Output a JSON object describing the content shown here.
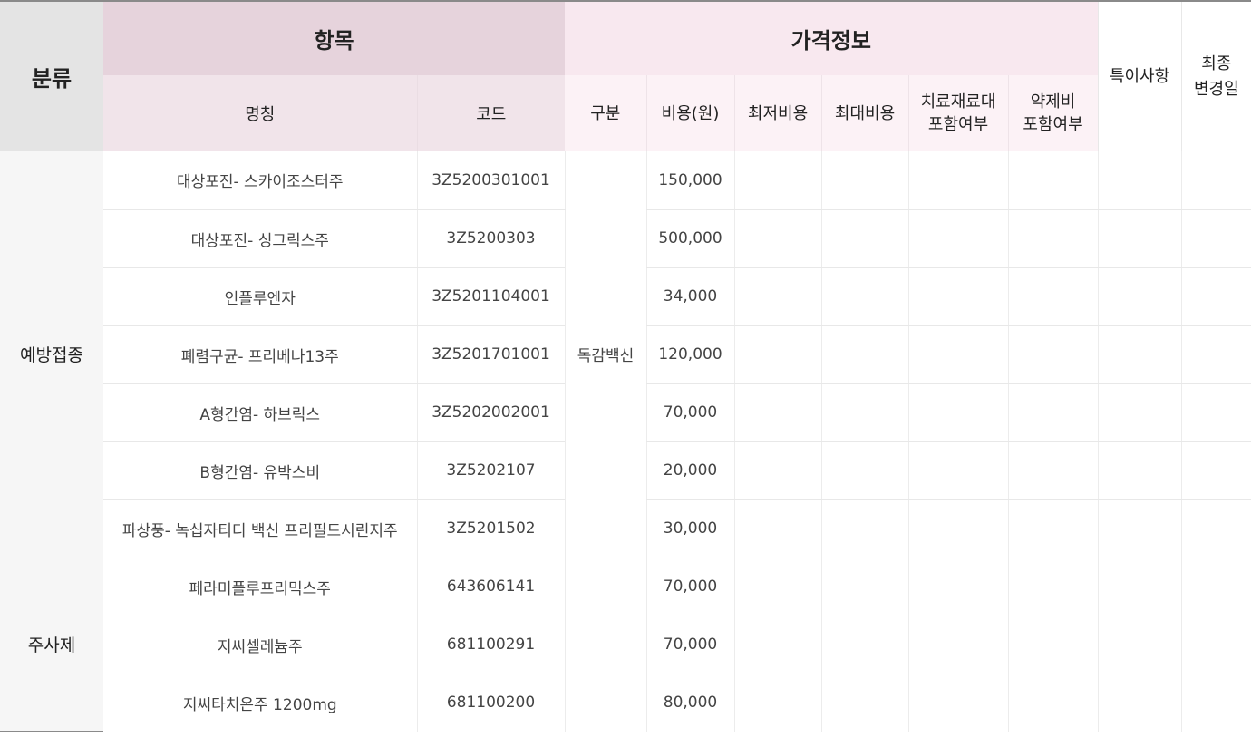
{
  "header": {
    "category": "분류",
    "group_item": "항목",
    "group_price": "가격정보",
    "special": "특이사항",
    "last_changed_1": "최종",
    "last_changed_2": "변경일",
    "name": "명칭",
    "code": "코드",
    "type": "구분",
    "cost": "비용(원)",
    "min_cost": "최저비용",
    "max_cost": "최대비용",
    "material_1": "치료재료대",
    "material_2": "포함여부",
    "drug_1": "약제비",
    "drug_2": "포함여부"
  },
  "categories": [
    "예방접종",
    "주사제"
  ],
  "type_label": "독감백신",
  "rows": [
    {
      "name": "대상포진- 스카이조스터주",
      "code": "3Z5200301001",
      "cost": "150,000"
    },
    {
      "name": "대상포진- 싱그릭스주",
      "code": "3Z5200303",
      "cost": "500,000"
    },
    {
      "name": "인플루엔자",
      "code": "3Z5201104001",
      "cost": "34,000"
    },
    {
      "name": "폐렴구균- 프리베나13주",
      "code": "3Z5201701001",
      "cost": "120,000"
    },
    {
      "name": "A형간염- 하브릭스",
      "code": "3Z5202002001",
      "cost": "70,000"
    },
    {
      "name": "B형간염- 유박스비",
      "code": "3Z5202107",
      "cost": "20,000"
    },
    {
      "name": "파상풍- 녹십자티디 백신 프리필드시린지주",
      "code": "3Z5201502",
      "cost": "30,000"
    },
    {
      "name": "페라미플루프리믹스주",
      "code": "643606141",
      "cost": "70,000"
    },
    {
      "name": "지씨셀레늄주",
      "code": "681100291",
      "cost": "70,000"
    },
    {
      "name": "지씨타치온주 1200mg",
      "code": "681100200",
      "cost": "80,000"
    }
  ]
}
